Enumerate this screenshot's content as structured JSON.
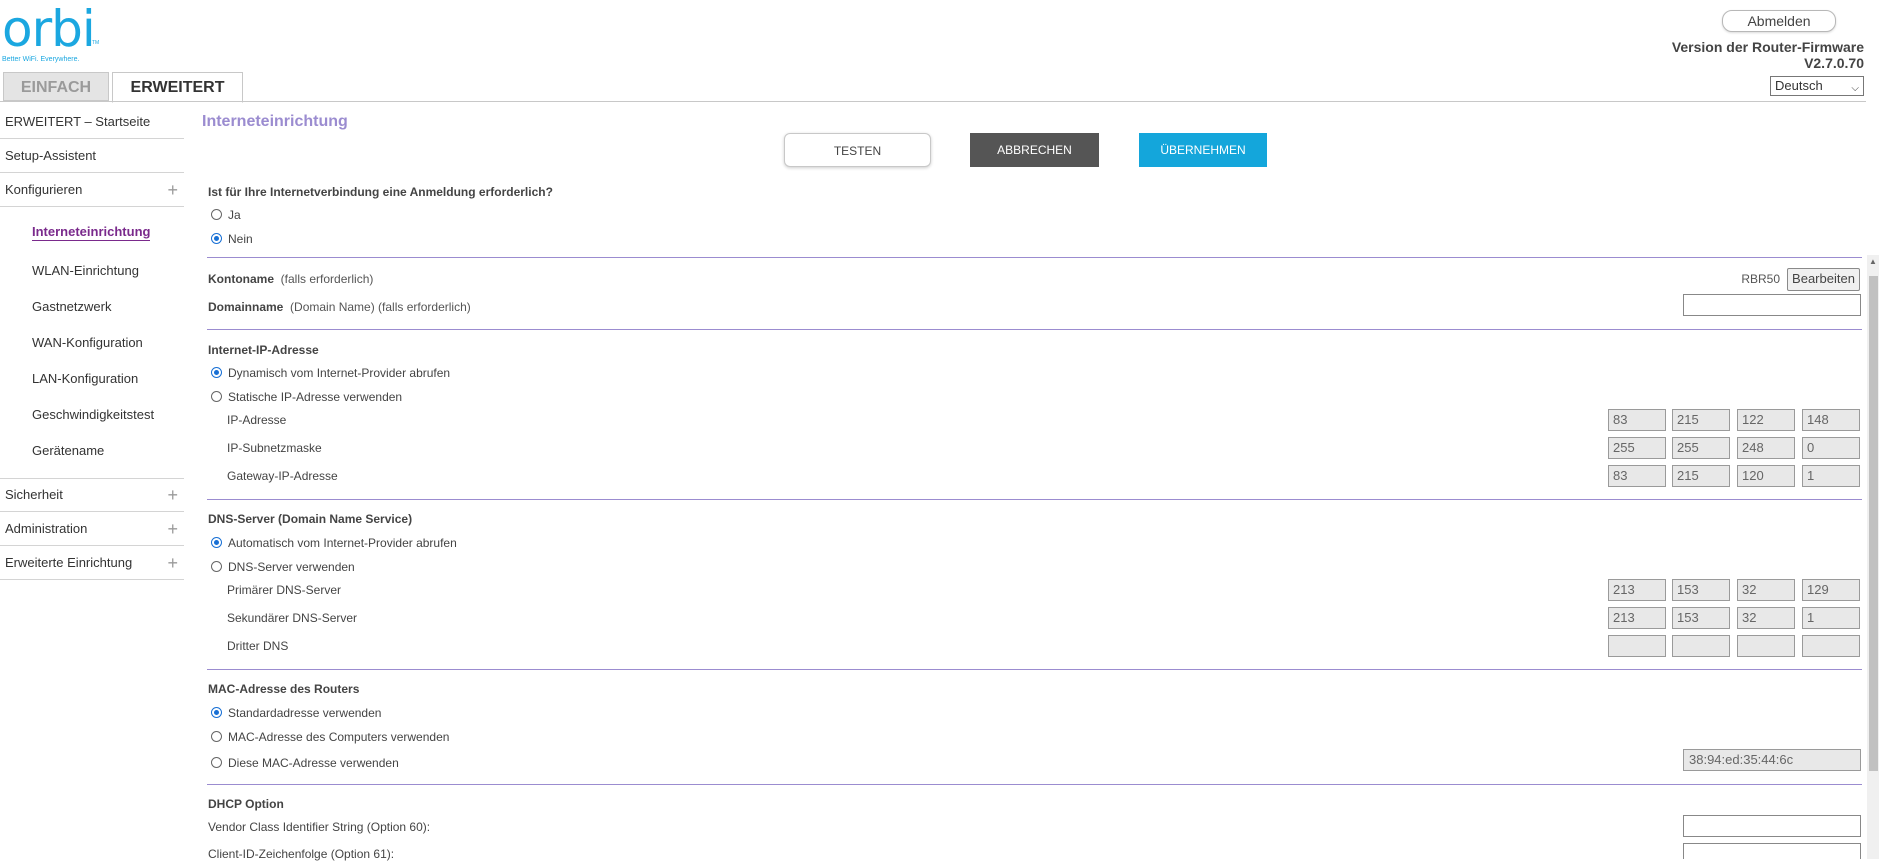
{
  "header": {
    "logo_text": "orbi",
    "logo_tm": "TM",
    "logo_tagline": "Better WiFi. Everywhere.",
    "logout_label": "Abmelden",
    "firmware_label": "Version der Router-Firmware",
    "firmware_version": "V2.7.0.70",
    "language": "Deutsch"
  },
  "tabs": [
    {
      "label": "EINFACH",
      "active": false
    },
    {
      "label": "ERWEITERT",
      "active": true
    }
  ],
  "sidebar": {
    "items": [
      {
        "label": "ERWEITERT – Startseite"
      },
      {
        "label": "Setup-Assistent"
      },
      {
        "label": "Konfigurieren",
        "expand": "+"
      },
      {
        "label": "Sicherheit",
        "expand": "+"
      },
      {
        "label": "Administration",
        "expand": "+"
      },
      {
        "label": "Erweiterte Einrichtung",
        "expand": "+"
      }
    ],
    "sub_items": [
      {
        "label": "Interneteinrichtung",
        "active": true
      },
      {
        "label": "WLAN-Einrichtung"
      },
      {
        "label": "Gastnetzwerk"
      },
      {
        "label": "WAN-Konfiguration"
      },
      {
        "label": "LAN-Konfiguration"
      },
      {
        "label": "Geschwindigkeitstest"
      },
      {
        "label": "Gerätename"
      }
    ]
  },
  "main": {
    "title": "Interneteinrichtung",
    "buttons": {
      "test": "TESTEN",
      "cancel": "ABBRECHEN",
      "apply": "ÜBERNEHMEN"
    },
    "login_question": "Ist für Ihre Internetverbindung eine Anmeldung erforderlich?",
    "login_yes": "Ja",
    "login_no": "Nein",
    "login_selected": "Nein",
    "account_label": "Kontoname",
    "account_hint": "(falls erforderlich)",
    "account_value": "RBR50",
    "edit_button": "Bearbeiten",
    "domain_label": "Domainname",
    "domain_hint": "(Domain Name) (falls erforderlich)",
    "domain_value": "",
    "ip_section": {
      "title": "Internet-IP-Adresse",
      "opt_dynamic": "Dynamisch vom Internet-Provider abrufen",
      "opt_static": "Statische IP-Adresse verwenden",
      "selected": "dynamic",
      "ip_label": "IP-Adresse",
      "ip": [
        "83",
        "215",
        "122",
        "148"
      ],
      "mask_label": "IP-Subnetzmaske",
      "mask": [
        "255",
        "255",
        "248",
        "0"
      ],
      "gateway_label": "Gateway-IP-Adresse",
      "gateway": [
        "83",
        "215",
        "120",
        "1"
      ]
    },
    "dns_section": {
      "title": "DNS-Server (Domain Name Service)",
      "opt_auto": "Automatisch vom Internet-Provider abrufen",
      "opt_manual": "DNS-Server verwenden",
      "selected": "auto",
      "primary_label": "Primärer DNS-Server",
      "primary": [
        "213",
        "153",
        "32",
        "129"
      ],
      "secondary_label": "Sekundärer DNS-Server",
      "secondary": [
        "213",
        "153",
        "32",
        "1"
      ],
      "third_label": "Dritter DNS",
      "third": [
        "",
        "",
        "",
        ""
      ]
    },
    "mac_section": {
      "title": "MAC-Adresse des Routers",
      "opt_default": "Standardadresse verwenden",
      "opt_computer": "MAC-Adresse des Computers verwenden",
      "opt_custom": "Diese MAC-Adresse verwenden",
      "selected": "default",
      "mac_value": "38:94:ed:35:44:6c"
    },
    "dhcp_section": {
      "title": "DHCP Option",
      "vendor_label": "Vendor Class Identifier String (Option 60):",
      "vendor_value": "",
      "client_label": "Client-ID-Zeichenfolge (Option 61):",
      "client_value": ""
    }
  }
}
